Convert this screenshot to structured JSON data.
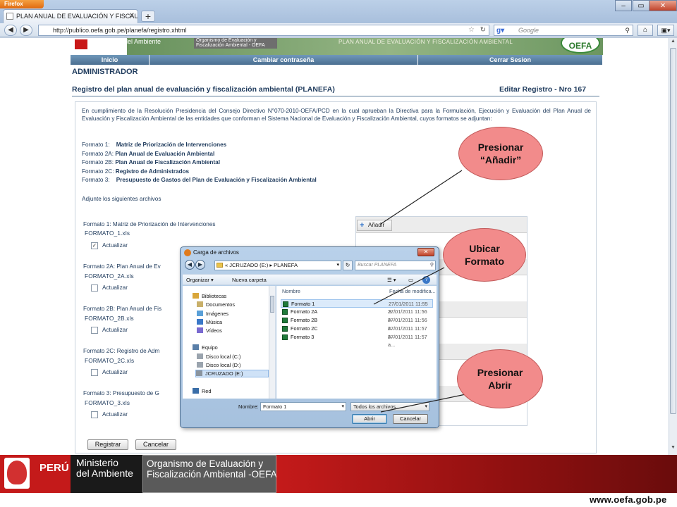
{
  "browser": {
    "app_button": "Firefox",
    "tab_title": "PLAN ANUAL DE EVALUACIÓN Y FISCAL...",
    "new_tab": "+",
    "url": "http://publico.oefa.gob.pe/planefa/registro.xhtml",
    "search_placeholder": "Google",
    "window_controls": [
      "–",
      "▭",
      "✕"
    ]
  },
  "banner": {
    "ministry": "del Ambiente",
    "org": "Organismo de Evaluación y Fiscalización Ambiental - OEFA",
    "title": "PLAN ANUAL DE EVALUACIÓN Y FISCALIZACIÓN AMBIENTAL",
    "logo": "OEFA"
  },
  "menu": [
    "Inicio",
    "Cambiar contraseña",
    "Cerrar Sesion"
  ],
  "page": {
    "role": "ADMINISTRADOR",
    "title": "Registro del plan anual de evaluación y fiscalización ambiental (PLANEFA)",
    "edit": "Editar Registro - Nro 167",
    "intro": "En cumplimiento de la Resolución Presidencia del Consejo Directivo N°070-2010-OEFA/PCD en la cual aprueban la Directiva para la Formulación, Ejecución y Evaluación del Plan Anual de Evaluación y Fiscalización Ambiental de las entidades que conforman el Sistema Nacional de Evaluación y Fiscalización Ambiental, cuyos formatos se adjuntan:",
    "formats": [
      {
        "code": "Formato 1:",
        "name": "Matriz de Priorización de Intervenciones"
      },
      {
        "code": "Formato 2A:",
        "name": "Plan Anual de Evaluación Ambiental"
      },
      {
        "code": "Formato 2B:",
        "name": "Plan Anual de Fiscalización Ambiental"
      },
      {
        "code": "Formato 2C:",
        "name": "Registro de Administrados"
      },
      {
        "code": "Formato 3:",
        "name": "Presupuesto de Gastos del Plan de Evaluación y Fiscalización Ambiental"
      }
    ],
    "attach": "Adjunte los siguientes archivos",
    "sections": [
      {
        "label": "Formato 1: Matriz de Priorización de Intervenciones",
        "file": "FORMATO_1.xls",
        "update": "Actualizar",
        "checked": true
      },
      {
        "label": "Formato 2A: Plan Anual de Ev",
        "file": "FORMATO_2A.xls",
        "update": "Actualizar",
        "checked": false
      },
      {
        "label": "Formato 2B: Plan Anual de Fis",
        "file": "FORMATO_2B.xls",
        "update": "Actualizar",
        "checked": false
      },
      {
        "label": "Formato 2C: Registro de Adm",
        "file": "FORMATO_2C.xls",
        "update": "Actualizar",
        "checked": false
      },
      {
        "label": "Formato 3: Presupuesto de G",
        "file": "FORMATO_3.xls",
        "update": "Actualizar",
        "checked": false
      }
    ],
    "add_button": "Añadir",
    "register_button": "Registrar",
    "cancel_button": "Cancelar"
  },
  "dialog": {
    "title": "Carga de archivos",
    "path": "« JCRUZADO (E:) ▸ PLANEFA",
    "search_placeholder": "Buscar PLANEFA",
    "organize": "Organizar ▾",
    "new_folder": "Nueva carpeta",
    "nav": [
      {
        "label": "Bibliotecas",
        "color": "#d9a63a"
      },
      {
        "label": "Documentos",
        "color": "#c9b06a"
      },
      {
        "label": "Imágenes",
        "color": "#5aa0d8"
      },
      {
        "label": "Música",
        "color": "#3a78c8"
      },
      {
        "label": "Vídeos",
        "color": "#7a6ad0"
      },
      {
        "label": "Equipo",
        "color": "#5a7fa8"
      },
      {
        "label": "Disco local (C:)",
        "color": "#9aa4ae"
      },
      {
        "label": "Disco local (D:)",
        "color": "#9aa4ae"
      },
      {
        "label": "JCRUZADO (E:)",
        "color": "#8a949e"
      },
      {
        "label": "Red",
        "color": "#3a6ea8"
      }
    ],
    "col_name": "Nombre",
    "col_date": "Fecha de modifica...",
    "files": [
      {
        "name": "Formato 1",
        "date": "27/01/2011 11:55 a..."
      },
      {
        "name": "Formato 2A",
        "date": "27/01/2011 11:56 a..."
      },
      {
        "name": "Formato 2B",
        "date": "27/01/2011 11:56 a..."
      },
      {
        "name": "Formato 2C",
        "date": "27/01/2011 11:57 a..."
      },
      {
        "name": "Formato 3",
        "date": "27/01/2011 11:57 a..."
      }
    ],
    "filename_label": "Nombre:",
    "filename": "Formato 1",
    "filter": "Todos los archivos",
    "open": "Abrir",
    "cancel": "Cancelar"
  },
  "callouts": {
    "add": "Presionar\n“Añadir”",
    "locate": "Ubicar\nFormato",
    "open": "Presionar\nAbrir",
    "color": "#f28b8b"
  },
  "footer": {
    "peru": "PERÚ",
    "ministry": "Ministerio\ndel Ambiente",
    "org": "Organismo de Evaluación y\nFiscalización Ambiental -OEFA",
    "url": "www.oefa.gob.pe"
  }
}
